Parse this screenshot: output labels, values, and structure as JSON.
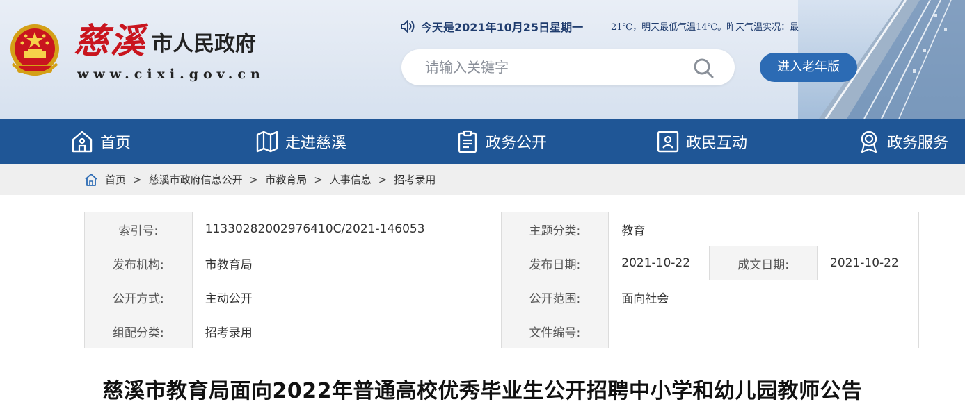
{
  "header": {
    "logo_cixi": "慈溪",
    "logo_gov": "市人民政府",
    "logo_url": "www.cixi.gov.cn",
    "date_text": "今天是2021年10月25日星期一",
    "weather_text": "21℃，明天最低气温14℃。昨天气温实况：最",
    "search_placeholder": "请输入关键字",
    "elder_button": "进入老年版",
    "icons": {
      "speaker": "speaker-icon",
      "search": "search-icon"
    }
  },
  "nav": {
    "items": [
      {
        "label": "首页",
        "icon": "home-icon"
      },
      {
        "label": "走进慈溪",
        "icon": "map-icon"
      },
      {
        "label": "政务公开",
        "icon": "clipboard-icon"
      },
      {
        "label": "政民互动",
        "icon": "user-card-icon"
      },
      {
        "label": "政务服务",
        "icon": "badge-icon"
      }
    ]
  },
  "breadcrumb": {
    "items": [
      "首页",
      "慈溪市政府信息公开",
      "市教育局",
      "人事信息",
      "招考录用"
    ],
    "separator": ">"
  },
  "info": {
    "index_label": "索引号:",
    "index_value": "11330282002976410C/2021-146053",
    "topic_label": "主题分类:",
    "topic_value": "教育",
    "publisher_label": "发布机构:",
    "publisher_value": "市教育局",
    "pubdate_label": "发布日期:",
    "pubdate_value": "2021-10-22",
    "docdate_label": "成文日期:",
    "docdate_value": "2021-10-22",
    "mode_label": "公开方式:",
    "mode_value": "主动公开",
    "scope_label": "公开范围:",
    "scope_value": "面向社会",
    "category_label": "组配分类:",
    "category_value": "招考录用",
    "docno_label": "文件编号:",
    "docno_value": ""
  },
  "article": {
    "title": "慈溪市教育局面向2022年普通高校优秀毕业生公开招聘中小学和幼儿园教师公告"
  },
  "colors": {
    "nav_bg": "#1f5696",
    "accent": "#2c6bb4",
    "logo_red": "#c9151e",
    "date_blue": "#1f3c6e"
  }
}
